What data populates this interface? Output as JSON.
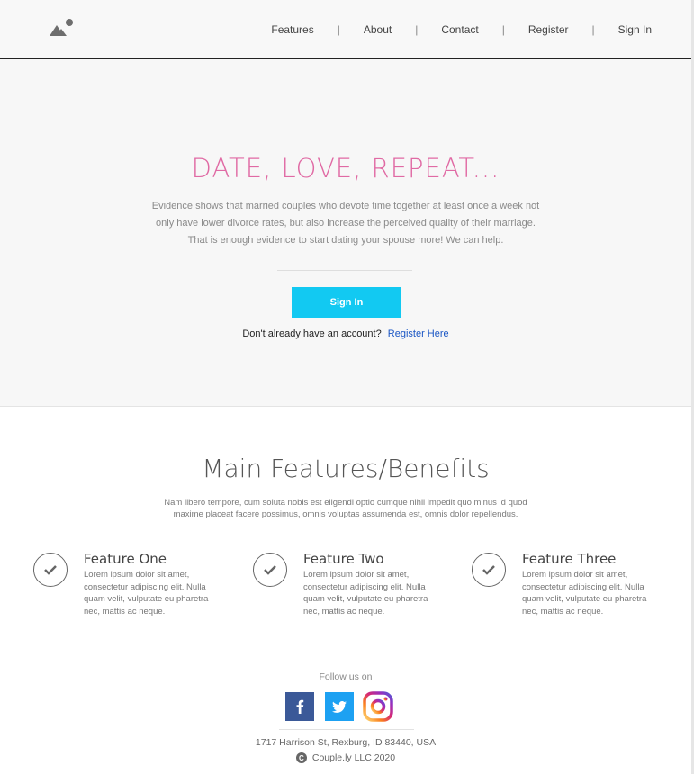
{
  "nav": {
    "items": [
      "Features",
      "About",
      "Contact",
      "Register",
      "Sign In"
    ],
    "separator": "|"
  },
  "hero": {
    "title": "DATE, LOVE, REPEAT...",
    "text": "Evidence shows that married couples who devote time together at least once a week not only have lower divorce rates, but also increase the perceived quality of their marriage. That is enough evidence to start dating your spouse more! We can help.",
    "signin_label": "Sign In",
    "register_prompt": "Don't already have an account?",
    "register_link": "Register Here",
    "accent_color": "#e06aa4",
    "button_color": "#12c9f2"
  },
  "features": {
    "title": "Main Features/Benefits",
    "subtitle": "Nam libero tempore, cum soluta nobis est eligendi optio cumque nihil impedit quo minus id quod maxime placeat facere possimus, omnis voluptas assumenda est, omnis dolor repellendus.",
    "items": [
      {
        "title": "Feature One",
        "text": "Lorem ipsum dolor sit amet, consectetur adipiscing elit. Nulla quam velit, vulputate eu pharetra nec, mattis ac neque.",
        "icon": "check-icon"
      },
      {
        "title": "Feature Two",
        "text": "Lorem ipsum dolor sit amet, consectetur adipiscing elit. Nulla quam velit, vulputate eu pharetra nec, mattis ac neque.",
        "icon": "check-icon"
      },
      {
        "title": "Feature Three",
        "text": "Lorem ipsum dolor sit amet, consectetur adipiscing elit. Nulla quam velit, vulputate eu pharetra nec, mattis ac neque.",
        "icon": "check-icon"
      }
    ]
  },
  "footer": {
    "follow": "Follow us on",
    "social": [
      "facebook-icon",
      "twitter-icon",
      "instagram-icon"
    ],
    "address": "1717 Harrison St, Rexburg, ID 83440, USA",
    "copyright": "Couple.ly LLC 2020"
  }
}
